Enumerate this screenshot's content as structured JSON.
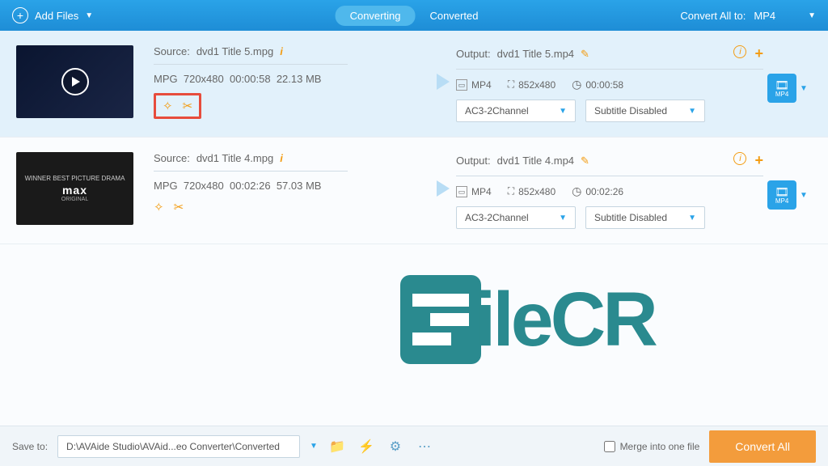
{
  "header": {
    "add_files_label": "Add Files",
    "tab_converting": "Converting",
    "tab_converted": "Converted",
    "convert_all_label": "Convert All to:",
    "convert_all_format": "MP4"
  },
  "items": [
    {
      "source_label": "Source:",
      "source_name": "dvd1 Title 5.mpg",
      "format": "MPG",
      "resolution": "720x480",
      "duration": "00:00:58",
      "size": "22.13 MB",
      "output_label": "Output:",
      "output_name": "dvd1 Title 5.mp4",
      "out_format": "MP4",
      "out_resolution": "852x480",
      "out_duration": "00:00:58",
      "audio_select": "AC3-2Channel",
      "subtitle_select": "Subtitle Disabled",
      "badge_format": "MP4",
      "selected": true,
      "highlighted_tools": true
    },
    {
      "source_label": "Source:",
      "source_name": "dvd1 Title 4.mpg",
      "format": "MPG",
      "resolution": "720x480",
      "duration": "00:02:26",
      "size": "57.03 MB",
      "output_label": "Output:",
      "output_name": "dvd1 Title 4.mp4",
      "out_format": "MP4",
      "out_resolution": "852x480",
      "out_duration": "00:02:26",
      "audio_select": "AC3-2Channel",
      "subtitle_select": "Subtitle Disabled",
      "badge_format": "MP4",
      "selected": false,
      "highlighted_tools": false
    }
  ],
  "footer": {
    "save_label": "Save to:",
    "save_path": "D:\\AVAide Studio\\AVAid...eo Converter\\Converted",
    "merge_label": "Merge into one file",
    "convert_btn": "Convert All"
  },
  "watermark_text": "ileCR"
}
